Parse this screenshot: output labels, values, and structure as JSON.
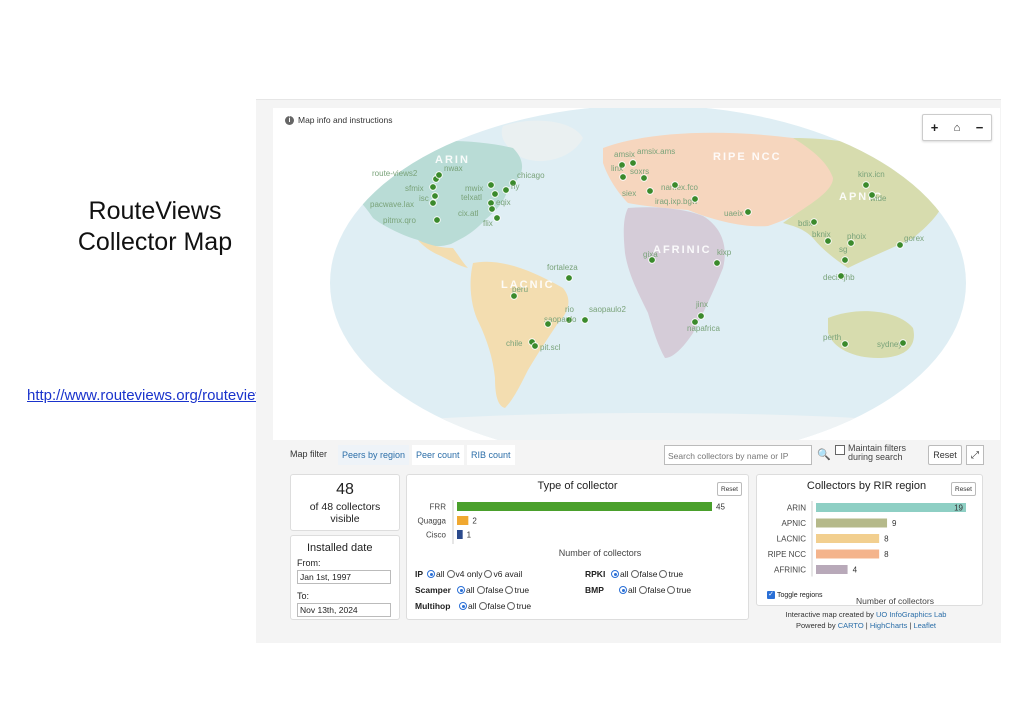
{
  "slide": {
    "title_line1": "RouteViews",
    "title_line2": "Collector Map",
    "link": "http://www.routeviews.org/routeviews/index.php/map/"
  },
  "map": {
    "info_text": "Map info and instructions",
    "zoom_in": "+",
    "home": "⌂",
    "zoom_out": "−",
    "regions": [
      {
        "name": "ARIN",
        "color": "#b9dcd6"
      },
      {
        "name": "RIPE NCC",
        "color": "#f6d6be"
      },
      {
        "name": "APNIC",
        "color": "#d7dcae"
      },
      {
        "name": "AFRINIC",
        "color": "#d5ccd8"
      },
      {
        "name": "LACNIC",
        "color": "#f3ddb0"
      }
    ],
    "collectors": [
      "route-views2",
      "nwax",
      "sfmix",
      "isc",
      "pacwave.lax",
      "pitmx.qro",
      "mwix",
      "chicago",
      "telxatl",
      "eqix",
      "ny",
      "cix.atl",
      "flix",
      "amsix",
      "amsix.ams",
      "linx",
      "soxrs",
      "siex",
      "namex.fco",
      "iraq.ixp.bgw",
      "uaeix",
      "kinx.icn",
      "wide",
      "bdix",
      "bknix",
      "phoix",
      "gorex",
      "sg",
      "decix.jhb",
      "gixa",
      "kixp",
      "napafrica",
      "jinx",
      "fortaleza",
      "peru",
      "rio",
      "saopaulo2",
      "saopaulo",
      "chile",
      "pit.scl",
      "perth",
      "sydney"
    ]
  },
  "filter": {
    "label": "Map filter",
    "tabs": [
      "Peers by region",
      "Peer count",
      "RIB count"
    ],
    "search_placeholder": "Search collectors by name or IP",
    "maintain_line1": "Maintain filters",
    "maintain_line2": "during search",
    "reset": "Reset"
  },
  "summary": {
    "count": "48",
    "count_text": "of 48 collectors visible",
    "installed_title": "Installed date",
    "from_label": "From:",
    "from_value": "Jan 1st, 1997",
    "to_label": "To:",
    "to_value": "Nov 13th, 2024"
  },
  "type_options": {
    "ip_label": "IP",
    "ip_opts": [
      "all",
      "v4 only",
      "v6 avail"
    ],
    "rpki_label": "RPKI",
    "rpki_opts": [
      "all",
      "false",
      "true"
    ],
    "scamper_label": "Scamper",
    "scamper_opts": [
      "all",
      "false",
      "true"
    ],
    "bmp_label": "BMP",
    "bmp_opts": [
      "all",
      "false",
      "true"
    ],
    "multihop_label": "Multihop",
    "multihop_opts": [
      "all",
      "false",
      "true"
    ]
  },
  "toggle_regions": "Toggle regions",
  "credits": {
    "line1_prefix": "Interactive map created by",
    "line1_link": "UO InfoGraphics Lab",
    "line2_prefix": "Powered by",
    "carto": "CARTO",
    "highcharts": "HighCharts",
    "leaflet": "Leaflet",
    "sep": "|"
  },
  "chart_data": [
    {
      "type": "bar",
      "title": "Type of collector",
      "reset": "Reset",
      "xlabel": "Number of collectors",
      "categories": [
        "FRR",
        "Quagga",
        "Cisco"
      ],
      "values": [
        45,
        2,
        1
      ],
      "colors": [
        "#4aa02c",
        "#f0a830",
        "#2b4a8c"
      ],
      "xlim": [
        0,
        45
      ]
    },
    {
      "type": "bar",
      "title": "Collectors by RIR region",
      "reset": "Reset",
      "xlabel": "Number of collectors",
      "categories": [
        "ARIN",
        "APNIC",
        "LACNIC",
        "RIPE NCC",
        "AFRINIC"
      ],
      "values": [
        19,
        9,
        8,
        8,
        4
      ],
      "colors": [
        "#8ecfc4",
        "#b5b98a",
        "#f2cf8f",
        "#f4b48c",
        "#b8a9b9"
      ],
      "xlim": [
        0,
        19
      ]
    }
  ]
}
